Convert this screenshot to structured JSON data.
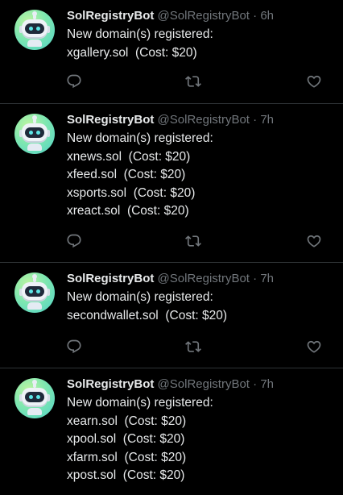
{
  "tweets": [
    {
      "name": "SolRegistryBot",
      "handle": "@SolRegistryBot",
      "dot": "·",
      "time": "6h",
      "lines": [
        "New domain(s) registered:",
        "xgallery.sol  (Cost: $20)"
      ]
    },
    {
      "name": "SolRegistryBot",
      "handle": "@SolRegistryBot",
      "dot": "·",
      "time": "7h",
      "lines": [
        "New domain(s) registered:",
        "xnews.sol  (Cost: $20)",
        "xfeed.sol  (Cost: $20)",
        "xsports.sol  (Cost: $20)",
        "xreact.sol  (Cost: $20)"
      ]
    },
    {
      "name": "SolRegistryBot",
      "handle": "@SolRegistryBot",
      "dot": "·",
      "time": "7h",
      "lines": [
        "New domain(s) registered:",
        "secondwallet.sol  (Cost: $20)"
      ]
    },
    {
      "name": "SolRegistryBot",
      "handle": "@SolRegistryBot",
      "dot": "·",
      "time": "7h",
      "lines": [
        "New domain(s) registered:",
        "xearn.sol  (Cost: $20)",
        "xpool.sol  (Cost: $20)",
        "xfarm.sol  (Cost: $20)",
        "xpost.sol  (Cost: $20)"
      ]
    }
  ],
  "icons": {
    "reply": "reply-icon",
    "retweet": "retweet-icon",
    "like": "heart-icon",
    "avatar": "robot-avatar"
  },
  "colors": {
    "background": "#000000",
    "text": "#e7e9ea",
    "muted": "#71767b",
    "divider": "#2f3336"
  }
}
